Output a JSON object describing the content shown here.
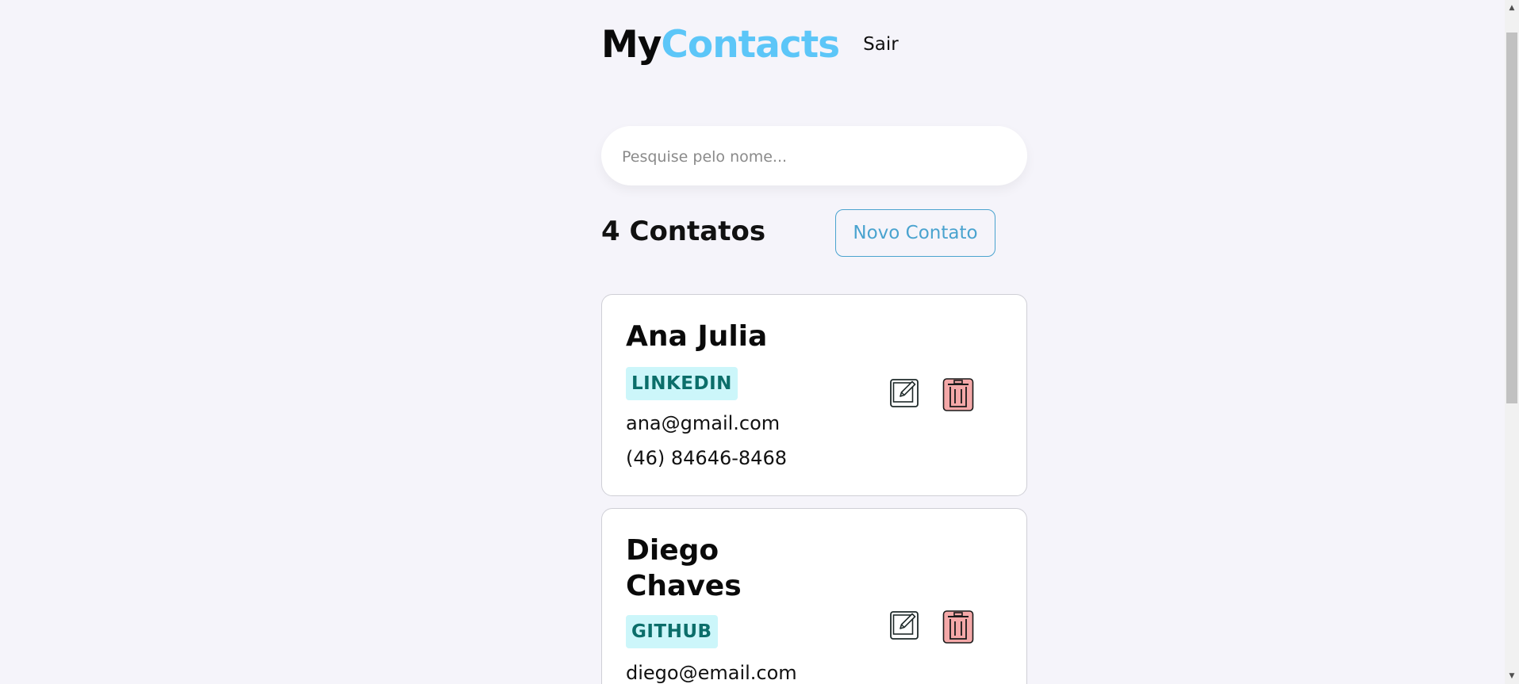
{
  "header": {
    "logo_part1": "My",
    "logo_part2": "Contacts",
    "logout_label": "Sair"
  },
  "search": {
    "placeholder": "Pesquise pelo nome...",
    "value": ""
  },
  "contacts_header": {
    "count_label": "4 Contatos",
    "new_contact_label": "Novo Contato"
  },
  "contacts": [
    {
      "name": "Ana Julia",
      "category": "LINKEDIN",
      "email": "ana@gmail.com",
      "phone": "(46) 84646-8468",
      "edit_icon": "edit-icon",
      "delete_icon": "trash-icon"
    },
    {
      "name": "Diego Chaves",
      "category": "GITHUB",
      "email": "diego@email.com",
      "edit_icon": "edit-icon",
      "delete_icon": "trash-icon"
    }
  ],
  "colors": {
    "background": "#f5f4fa",
    "accent": "#5cc6f8",
    "button_border": "#4aa3cf",
    "tag_bg": "#ccf6fa",
    "tag_text": "#0b6e6a",
    "delete_bg": "#f4a8a8"
  }
}
